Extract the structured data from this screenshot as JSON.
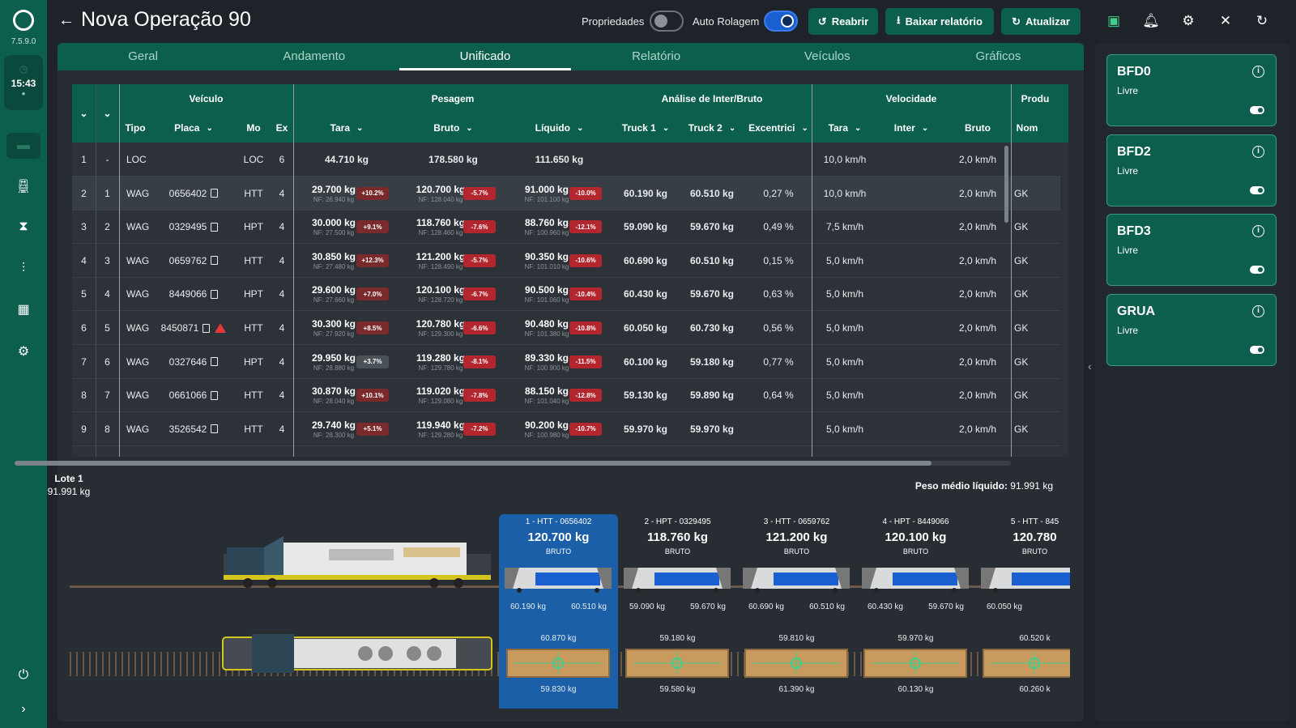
{
  "app": {
    "version": "7.5.9.0",
    "time": "15:43"
  },
  "header": {
    "title": "Nova Operação 90",
    "propriedades_label": "Propriedades",
    "auto_rolagem_label": "Auto Rolagem",
    "propriedades_on": false,
    "auto_rolagem_on": true,
    "reabrir_label": "Reabrir",
    "baixar_label": "Baixar relatório",
    "atualizar_label": "Atualizar"
  },
  "tabs": [
    {
      "label": "Geral",
      "active": false
    },
    {
      "label": "Andamento",
      "active": false
    },
    {
      "label": "Unificado",
      "active": true
    },
    {
      "label": "Relatório",
      "active": false
    },
    {
      "label": "Veículos",
      "active": false
    },
    {
      "label": "Gráficos",
      "active": false
    }
  ],
  "table": {
    "groups": [
      "Veículo",
      "Pesagem",
      "Análise de Inter/Bruto",
      "Velocidade",
      "Produ"
    ],
    "columns": [
      "Tipo",
      "Placa",
      "Mo",
      "Ex",
      "Tara",
      "Bruto",
      "Líquido",
      "Truck 1",
      "Truck 2",
      "Excentrici",
      "Tara",
      "Inter",
      "Bruto",
      "Nom"
    ],
    "rows": [
      {
        "n": "1",
        "s": "-",
        "tipo": "LOC",
        "placa": "",
        "mod": "LOC",
        "ex": "6",
        "tara": "44.710 kg",
        "tara_nf": "",
        "tara_d": "",
        "tara_t": "",
        "bruto": "178.580 kg",
        "bruto_nf": "",
        "bruto_d": "",
        "bruto_t": "",
        "liq": "111.650 kg",
        "liq_nf": "",
        "liq_d": "",
        "liq_t": "",
        "t1": "",
        "t2": "",
        "exc": "",
        "vt": "10,0 km/h",
        "vi": "",
        "vb": "2,0 km/h",
        "nom": "",
        "doc": false,
        "warn": false
      },
      {
        "n": "2",
        "s": "1",
        "tipo": "WAG",
        "placa": "0656402",
        "mod": "HTT",
        "ex": "4",
        "tara": "29.700 kg",
        "tara_nf": "NF: 26.940 kg",
        "tara_d": "+10.2%",
        "tara_t": "up",
        "bruto": "120.700 kg",
        "bruto_nf": "NF: 128.040 kg",
        "bruto_d": "-5.7%",
        "bruto_t": "dn",
        "liq": "91.000 kg",
        "liq_nf": "NF: 101.100 kg",
        "liq_d": "-10.0%",
        "liq_t": "dn",
        "t1": "60.190 kg",
        "t2": "60.510 kg",
        "exc": "0,27 %",
        "vt": "10,0 km/h",
        "vi": "",
        "vb": "2,0 km/h",
        "nom": "GK",
        "doc": true,
        "warn": false
      },
      {
        "n": "3",
        "s": "2",
        "tipo": "WAG",
        "placa": "0329495",
        "mod": "HPT",
        "ex": "4",
        "tara": "30.000 kg",
        "tara_nf": "NF: 27.500 kg",
        "tara_d": "+9.1%",
        "tara_t": "up",
        "bruto": "118.760 kg",
        "bruto_nf": "NF: 128.460 kg",
        "bruto_d": "-7.6%",
        "bruto_t": "dn",
        "liq": "88.760 kg",
        "liq_nf": "NF: 100.960 kg",
        "liq_d": "-12.1%",
        "liq_t": "dn",
        "t1": "59.090 kg",
        "t2": "59.670 kg",
        "exc": "0,49 %",
        "vt": "7,5 km/h",
        "vi": "",
        "vb": "2,0 km/h",
        "nom": "GK",
        "doc": true,
        "warn": false
      },
      {
        "n": "4",
        "s": "3",
        "tipo": "WAG",
        "placa": "0659762",
        "mod": "HTT",
        "ex": "4",
        "tara": "30.850 kg",
        "tara_nf": "NF: 27.480 kg",
        "tara_d": "+12.3%",
        "tara_t": "up",
        "bruto": "121.200 kg",
        "bruto_nf": "NF: 128.490 kg",
        "bruto_d": "-5.7%",
        "bruto_t": "dn",
        "liq": "90.350 kg",
        "liq_nf": "NF: 101.010 kg",
        "liq_d": "-10.6%",
        "liq_t": "dn",
        "t1": "60.690 kg",
        "t2": "60.510 kg",
        "exc": "0,15 %",
        "vt": "5,0 km/h",
        "vi": "",
        "vb": "2,0 km/h",
        "nom": "GK",
        "doc": true,
        "warn": false
      },
      {
        "n": "5",
        "s": "4",
        "tipo": "WAG",
        "placa": "8449066",
        "mod": "HPT",
        "ex": "4",
        "tara": "29.600 kg",
        "tara_nf": "NF: 27.660 kg",
        "tara_d": "+7.0%",
        "tara_t": "up",
        "bruto": "120.100 kg",
        "bruto_nf": "NF: 128.720 kg",
        "bruto_d": "-6.7%",
        "bruto_t": "dn",
        "liq": "90.500 kg",
        "liq_nf": "NF: 101.060 kg",
        "liq_d": "-10.4%",
        "liq_t": "dn",
        "t1": "60.430 kg",
        "t2": "59.670 kg",
        "exc": "0,63 %",
        "vt": "5,0 km/h",
        "vi": "",
        "vb": "2,0 km/h",
        "nom": "GK",
        "doc": true,
        "warn": false
      },
      {
        "n": "6",
        "s": "5",
        "tipo": "WAG",
        "placa": "8450871",
        "mod": "HTT",
        "ex": "4",
        "tara": "30.300 kg",
        "tara_nf": "NF: 27.920 kg",
        "tara_d": "+8.5%",
        "tara_t": "up",
        "bruto": "120.780 kg",
        "bruto_nf": "NF: 129.300 kg",
        "bruto_d": "-6.6%",
        "bruto_t": "dn",
        "liq": "90.480 kg",
        "liq_nf": "NF: 101.380 kg",
        "liq_d": "-10.8%",
        "liq_t": "dn",
        "t1": "60.050 kg",
        "t2": "60.730 kg",
        "exc": "0,56 %",
        "vt": "5,0 km/h",
        "vi": "",
        "vb": "2,0 km/h",
        "nom": "GK",
        "doc": true,
        "warn": true
      },
      {
        "n": "7",
        "s": "6",
        "tipo": "WAG",
        "placa": "0327646",
        "mod": "HPT",
        "ex": "4",
        "tara": "29.950 kg",
        "tara_nf": "NF: 28.880 kg",
        "tara_d": "+3.7%",
        "tara_t": "nt",
        "bruto": "119.280 kg",
        "bruto_nf": "NF: 129.780 kg",
        "bruto_d": "-8.1%",
        "bruto_t": "dn",
        "liq": "89.330 kg",
        "liq_nf": "NF: 100.900 kg",
        "liq_d": "-11.5%",
        "liq_t": "dn",
        "t1": "60.100 kg",
        "t2": "59.180 kg",
        "exc": "0,77 %",
        "vt": "5,0 km/h",
        "vi": "",
        "vb": "2,0 km/h",
        "nom": "GK",
        "doc": true,
        "warn": false
      },
      {
        "n": "8",
        "s": "7",
        "tipo": "WAG",
        "placa": "0661066",
        "mod": "HTT",
        "ex": "4",
        "tara": "30.870 kg",
        "tara_nf": "NF: 28.040 kg",
        "tara_d": "+10.1%",
        "tara_t": "up",
        "bruto": "119.020 kg",
        "bruto_nf": "NF: 129.080 kg",
        "bruto_d": "-7.8%",
        "bruto_t": "dn",
        "liq": "88.150 kg",
        "liq_nf": "NF: 101.040 kg",
        "liq_d": "-12.8%",
        "liq_t": "dn",
        "t1": "59.130 kg",
        "t2": "59.890 kg",
        "exc": "0,64 %",
        "vt": "5,0 km/h",
        "vi": "",
        "vb": "2,0 km/h",
        "nom": "GK",
        "doc": true,
        "warn": false
      },
      {
        "n": "9",
        "s": "8",
        "tipo": "WAG",
        "placa": "3526542",
        "mod": "HTT",
        "ex": "4",
        "tara": "29.740 kg",
        "tara_nf": "NF: 28.300 kg",
        "tara_d": "+5.1%",
        "tara_t": "up",
        "bruto": "119.940 kg",
        "bruto_nf": "NF: 129.280 kg",
        "bruto_d": "-7.2%",
        "bruto_t": "dn",
        "liq": "90.200 kg",
        "liq_nf": "NF: 100.980 kg",
        "liq_d": "-10.7%",
        "liq_t": "dn",
        "t1": "59.970 kg",
        "t2": "59.970 kg",
        "exc": "",
        "vt": "5,0 km/h",
        "vi": "",
        "vb": "2,0 km/h",
        "nom": "GK",
        "doc": true,
        "warn": false
      }
    ]
  },
  "lote": {
    "label": "Lote 1",
    "value": "91.991 kg",
    "peso_label": "Peso médio líquido:",
    "peso_value": "91.991 kg"
  },
  "wagons": [
    {
      "title": "1 - HTT - 0656402",
      "bruto": "120.700 kg",
      "bruto_label": "BRUTO",
      "t1": "60.190 kg",
      "t2": "60.510 kg",
      "top": "60.870 kg",
      "bottom": "59.830 kg",
      "selected": true
    },
    {
      "title": "2 - HPT - 0329495",
      "bruto": "118.760 kg",
      "bruto_label": "BRUTO",
      "t1": "59.090 kg",
      "t2": "59.670 kg",
      "top": "59.180 kg",
      "bottom": "59.580 kg",
      "selected": false
    },
    {
      "title": "3 - HTT - 0659762",
      "bruto": "121.200 kg",
      "bruto_label": "BRUTO",
      "t1": "60.690 kg",
      "t2": "60.510 kg",
      "top": "59.810 kg",
      "bottom": "61.390 kg",
      "selected": false
    },
    {
      "title": "4 - HPT - 8449066",
      "bruto": "120.100 kg",
      "bruto_label": "BRUTO",
      "t1": "60.430 kg",
      "t2": "59.670 kg",
      "top": "59.970 kg",
      "bottom": "60.130 kg",
      "selected": false
    },
    {
      "title": "5 - HTT - 845",
      "bruto": "120.780",
      "bruto_label": "BRUTO",
      "t1": "60.050 kg",
      "t2": "",
      "top": "60.520 k",
      "bottom": "60.260 k",
      "selected": false
    }
  ],
  "balances": [
    {
      "name": "BFD0",
      "status": "Livre"
    },
    {
      "name": "BFD2",
      "status": "Livre"
    },
    {
      "name": "BFD3",
      "status": "Livre"
    },
    {
      "name": "GRUA",
      "status": "Livre"
    }
  ]
}
